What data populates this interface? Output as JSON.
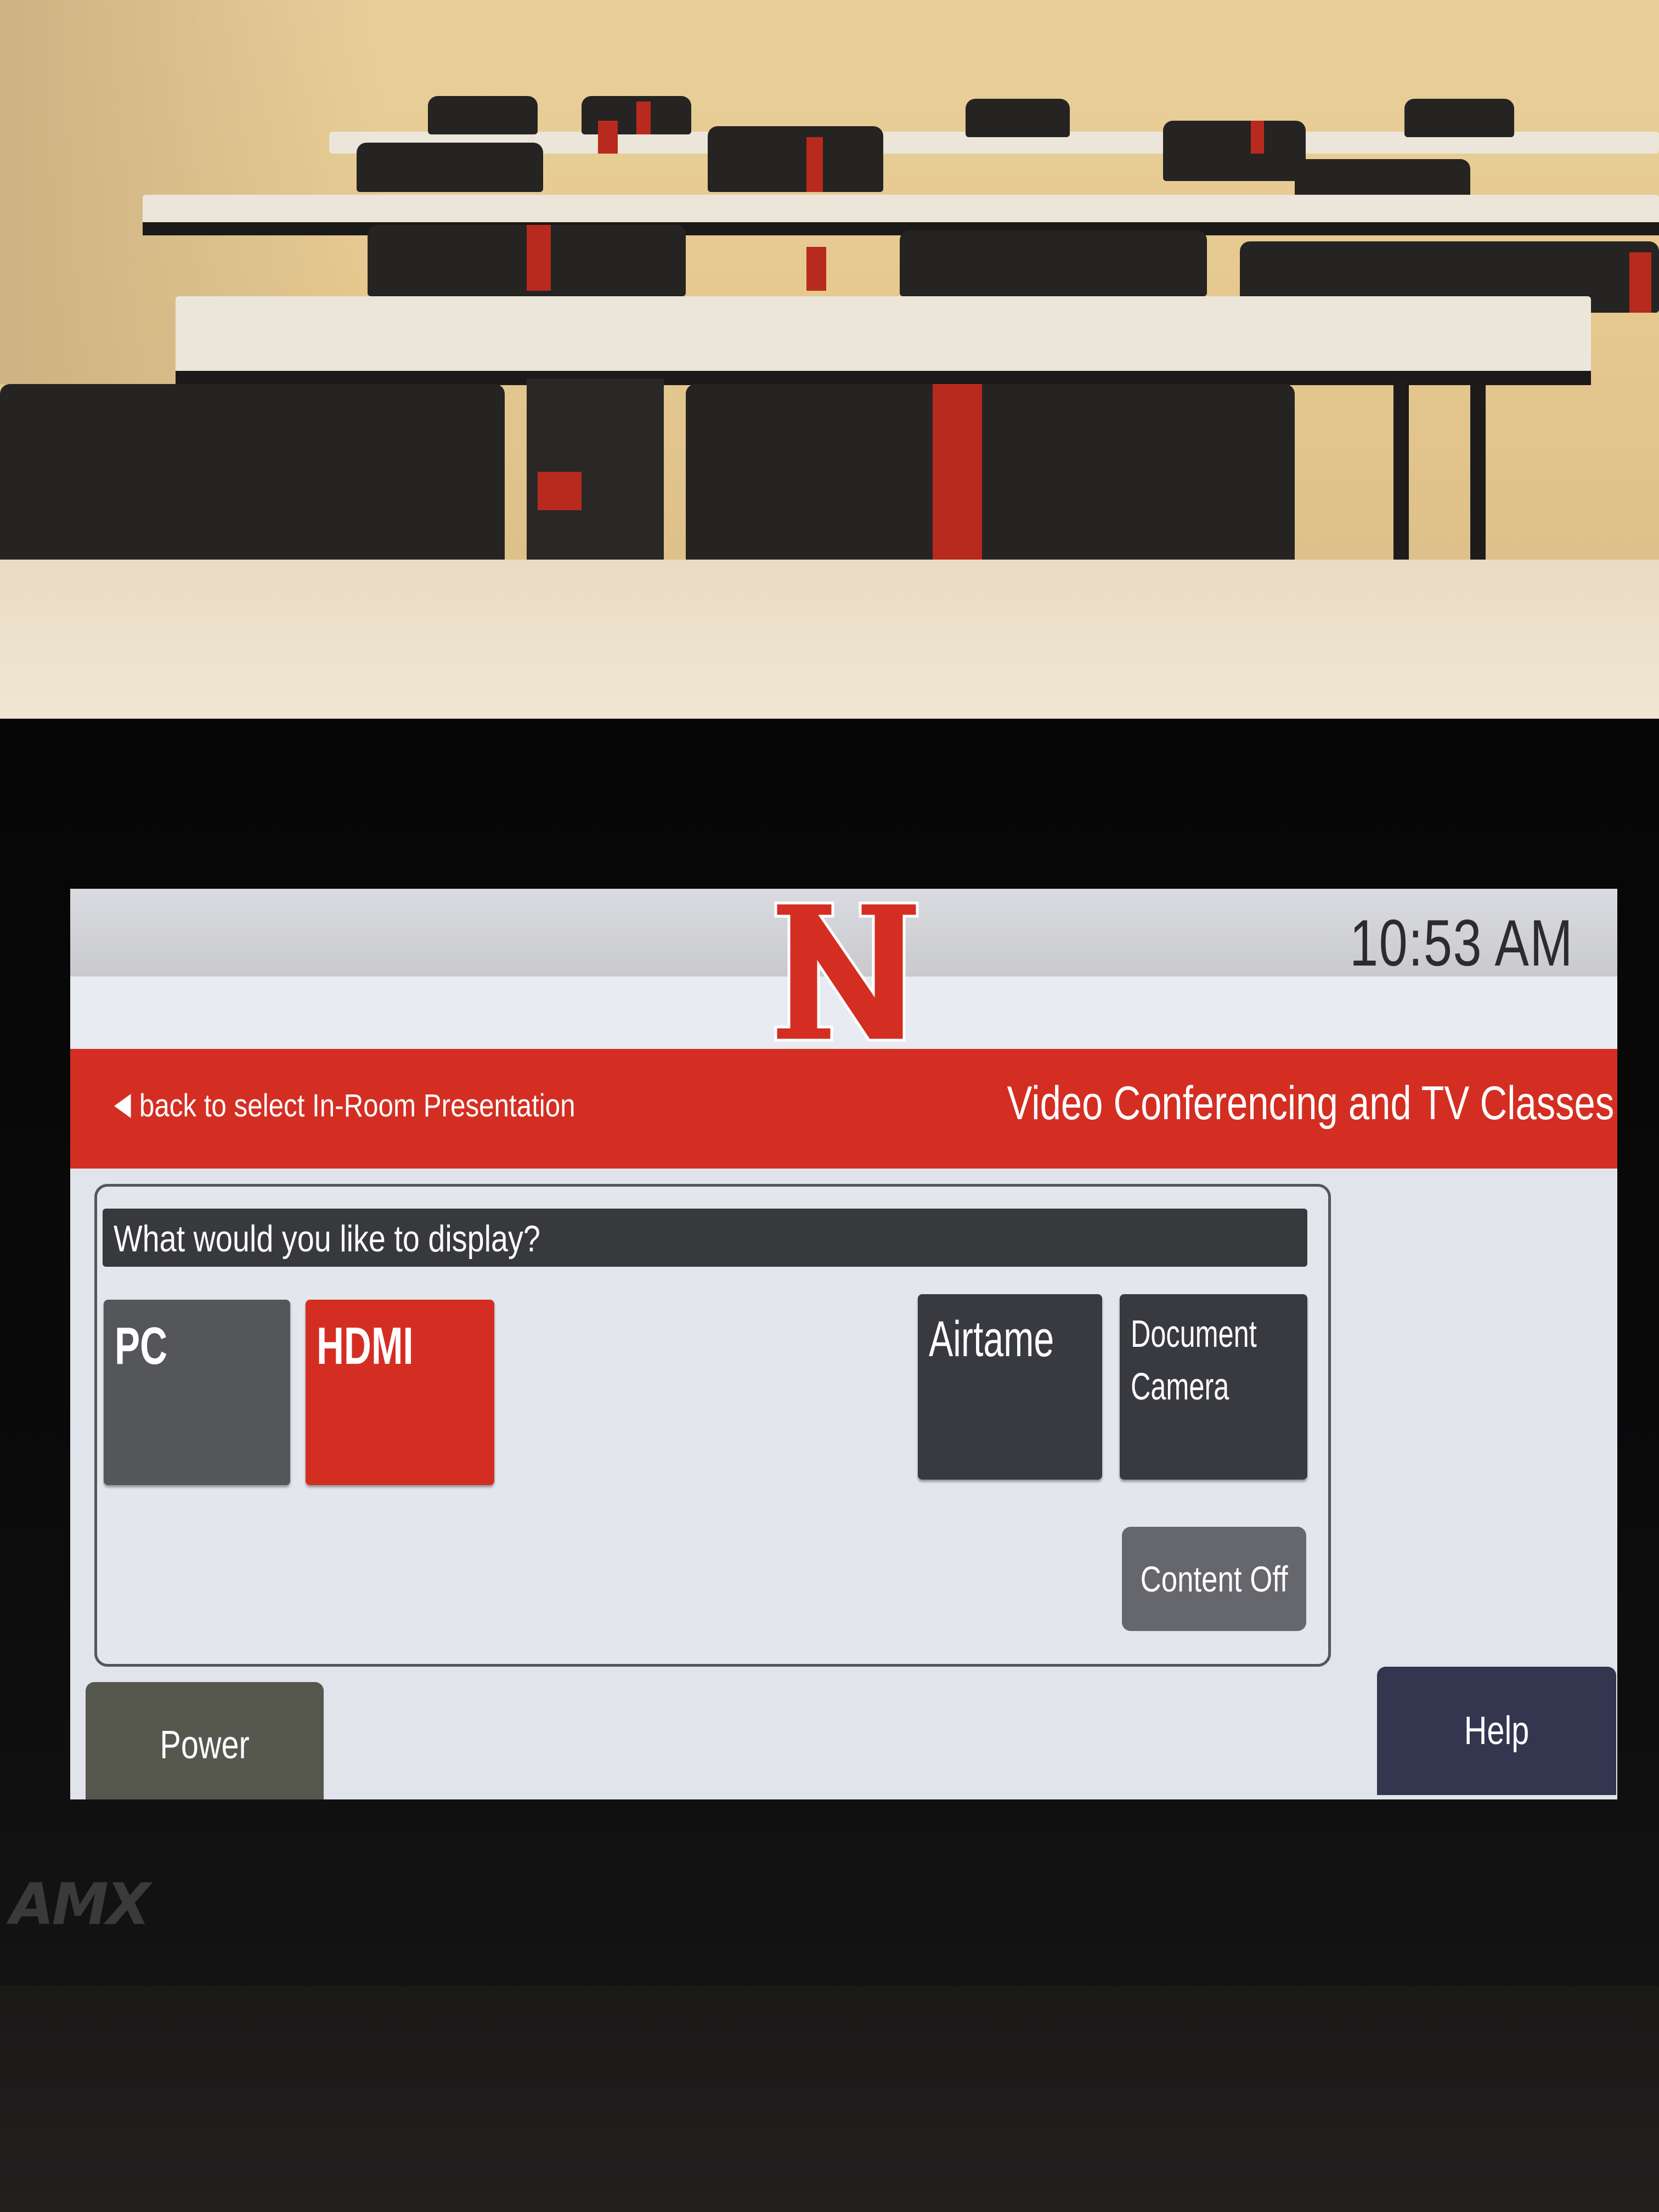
{
  "device": {
    "brand_logo_text": "AMX"
  },
  "header": {
    "logo_letter": "N",
    "clock": "10:53 AM"
  },
  "navbar": {
    "back_label": "back to select In-Room Presentation",
    "page_title": "Video Conferencing and TV Classes"
  },
  "source_panel": {
    "prompt": "What would you like to display?",
    "sources": [
      {
        "label": "PC",
        "selected": false
      },
      {
        "label": "HDMI",
        "selected": true
      },
      {
        "label": "Airtame",
        "selected": false
      },
      {
        "label": "Document Camera",
        "selected": false
      }
    ],
    "content_off_label": "Content Off"
  },
  "footer": {
    "power_label": "Power",
    "help_label": "Help"
  },
  "colors": {
    "brand_red": "#d42e23",
    "dark_button": "#393a3f",
    "gray_button": "#55565a",
    "help_button": "#34354f",
    "power_button": "#56574d"
  },
  "icons": {
    "back": "left-triangle-icon",
    "logo": "nebraska-n-logo"
  }
}
